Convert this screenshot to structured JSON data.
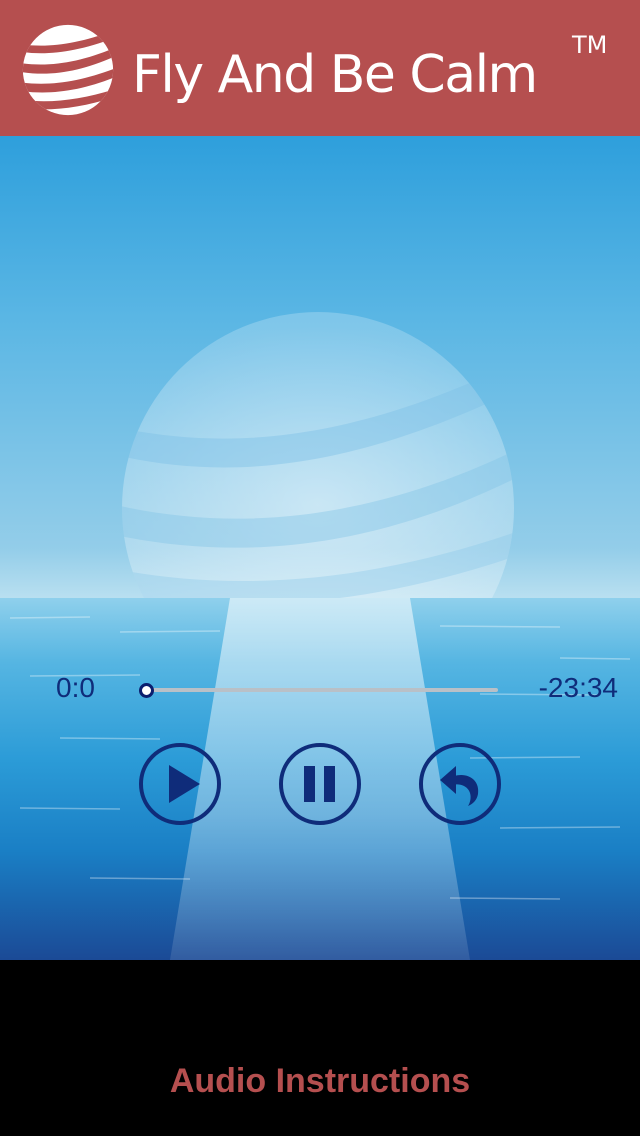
{
  "header": {
    "app_title": "Fly And Be Calm",
    "trademark": "TM",
    "logo_icon": "striped-globe-logo",
    "background_color": "#b54f4f"
  },
  "player": {
    "elapsed": "0:0",
    "remaining": "-23:34",
    "progress": 0,
    "controls": [
      {
        "name": "play",
        "icon": "play-icon"
      },
      {
        "name": "pause",
        "icon": "pause-icon"
      },
      {
        "name": "replay",
        "icon": "replay-icon"
      }
    ],
    "accent_color": "#0f2c7a"
  },
  "footer": {
    "link_label": "Audio Instructions",
    "link_color": "#b54f4f"
  }
}
